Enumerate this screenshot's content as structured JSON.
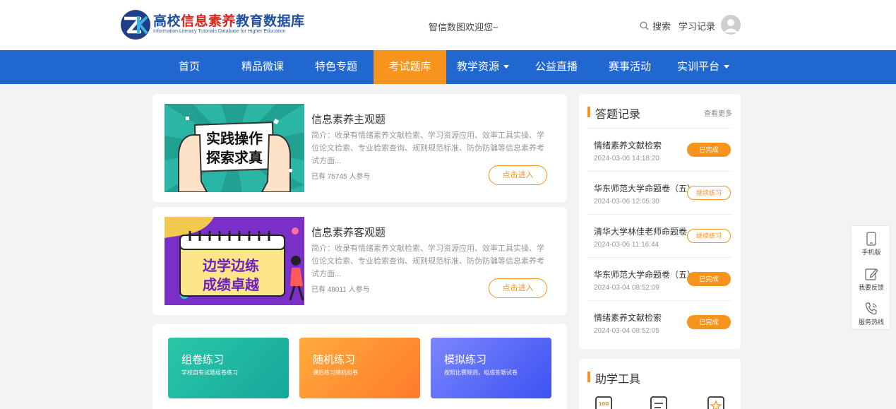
{
  "header": {
    "logo_title_blue1": "高校",
    "logo_title_red": "信息素养",
    "logo_title_blue2": "教育数据库",
    "logo_subtitle": "Information Literacy Tutorials Database for Higher Education",
    "welcome": "智信数图欢迎您~",
    "search_label": "搜索",
    "record_label": "学习记录"
  },
  "nav": {
    "items": [
      {
        "label": "首页"
      },
      {
        "label": "精品微课"
      },
      {
        "label": "特色专题"
      },
      {
        "label": "考试题库"
      },
      {
        "label": "教学资源"
      },
      {
        "label": "公益直播"
      },
      {
        "label": "赛事活动"
      },
      {
        "label": "实训平台"
      }
    ],
    "active_index": 3
  },
  "quizzes": [
    {
      "title": "信息素养主观题",
      "desc": "简介：收录有情绪素养文献检索、学习资源应用、效率工具实操、学位论文检索、专业检索查询、规则规范标准、防伪防骗等信息素养考试方面...",
      "count": "已有 75745 人参与",
      "button": "点击进入",
      "banner_line1": "实践操作",
      "banner_line2": "探索求真"
    },
    {
      "title": "信息素养客观题",
      "desc": "简介：收录有情绪素养文献检索、学习资源应用、效率工具实操、学位论文检索、专业检索查询、规则规范标准、防伪防骗等信息素养考试方面...",
      "count": "已有 48011 人参与",
      "button": "点击进入",
      "banner_line1": "边学边练",
      "banner_line2": "成绩卓越"
    }
  ],
  "practice": [
    {
      "title": "组卷练习",
      "sub": "学校自有试题组卷练习",
      "color_from": "#2cc6a8",
      "color_to": "#14a89a"
    },
    {
      "title": "随机练习",
      "sub": "课后练习随机组卷",
      "color_from": "#ffab3d",
      "color_to": "#ff7a2a"
    },
    {
      "title": "模拟练习",
      "sub": "按照比赛规则，组成答题试卷",
      "color_from": "#7b86ff",
      "color_to": "#3d52f0"
    }
  ],
  "answers": {
    "title": "答题记录",
    "more": "查看更多",
    "records": [
      {
        "name": "情绪素养文献检索",
        "time": "2024-03-06 14:18:20",
        "status": "已完成",
        "state": "done"
      },
      {
        "name": "华东师范大学命题卷（五）",
        "time": "2024-03-06 12:05:30",
        "status": "继续练习",
        "state": "cont"
      },
      {
        "name": "清华大学林佳老师命题卷",
        "time": "2024-03-06 11:16:44",
        "status": "继续练习",
        "state": "cont"
      },
      {
        "name": "华东师范大学命题卷（五）",
        "time": "2024-03-04 08:52:09",
        "status": "已完成",
        "state": "done"
      },
      {
        "name": "情绪素养文献检索",
        "time": "2024-03-04 08:52:05",
        "status": "已完成",
        "state": "done"
      }
    ]
  },
  "tools": {
    "title": "助学工具",
    "icons": [
      "score-100-icon",
      "list-document-icon",
      "star-book-icon"
    ]
  },
  "side_float": {
    "items": [
      {
        "label": "手机版",
        "icon": "mobile-icon"
      },
      {
        "label": "我要反馈",
        "icon": "edit-icon"
      },
      {
        "label": "服务热线",
        "icon": "phone-icon"
      }
    ]
  },
  "colors": {
    "nav_blue": "#2167d0",
    "accent_orange": "#f7941d",
    "page_bg": "#f2f3f5"
  }
}
